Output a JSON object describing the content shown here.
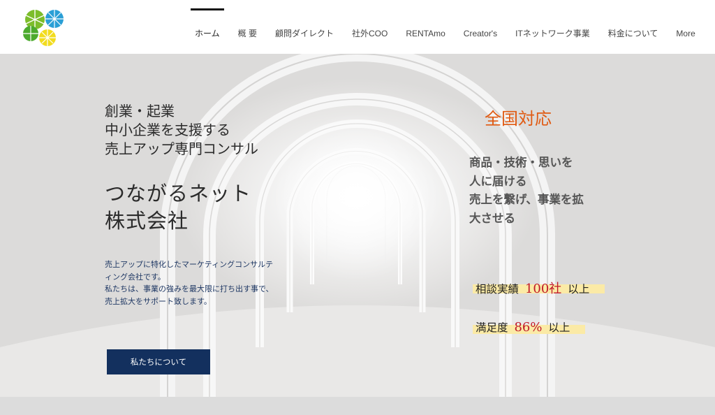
{
  "nav": {
    "items": [
      {
        "label": "ホーム",
        "active": true
      },
      {
        "label": "概 要"
      },
      {
        "label": "顧問ダイレクト"
      },
      {
        "label": "社外COO"
      },
      {
        "label": "RENTAmo"
      },
      {
        "label": "Creator's"
      },
      {
        "label": "ITネットワーク事業"
      },
      {
        "label": "料金について"
      },
      {
        "label": "More"
      }
    ]
  },
  "hero": {
    "tagline": [
      "創業・起業",
      "中小企業を支援する",
      "売上アップ専門コンサル"
    ],
    "company": [
      "つながるネット",
      "株式会社"
    ],
    "description": [
      "売上アップに特化したマーケティングコンサルテ",
      "ィング会社です。",
      "私たちは、事業の強みを最大限に打ち出す事で、",
      "売上拡大をサポート致します。"
    ],
    "button_label": "私たちについて",
    "national": "全国対応",
    "mission": [
      "商品・技術・思いを",
      "人に届ける",
      "売上を繋げ、事業を拡",
      "大させる"
    ],
    "stat1": {
      "prefix": "相談実績",
      "value": "100社",
      "suffix": "以上"
    },
    "stat2": {
      "prefix": "満足度",
      "value": "86%",
      "suffix": "以上"
    }
  },
  "colors": {
    "button_bg": "#13305e",
    "accent_orange": "#e05a12",
    "accent_red": "#c0192b",
    "highlight": "#fbeaa6",
    "description_text": "#1f3864"
  }
}
